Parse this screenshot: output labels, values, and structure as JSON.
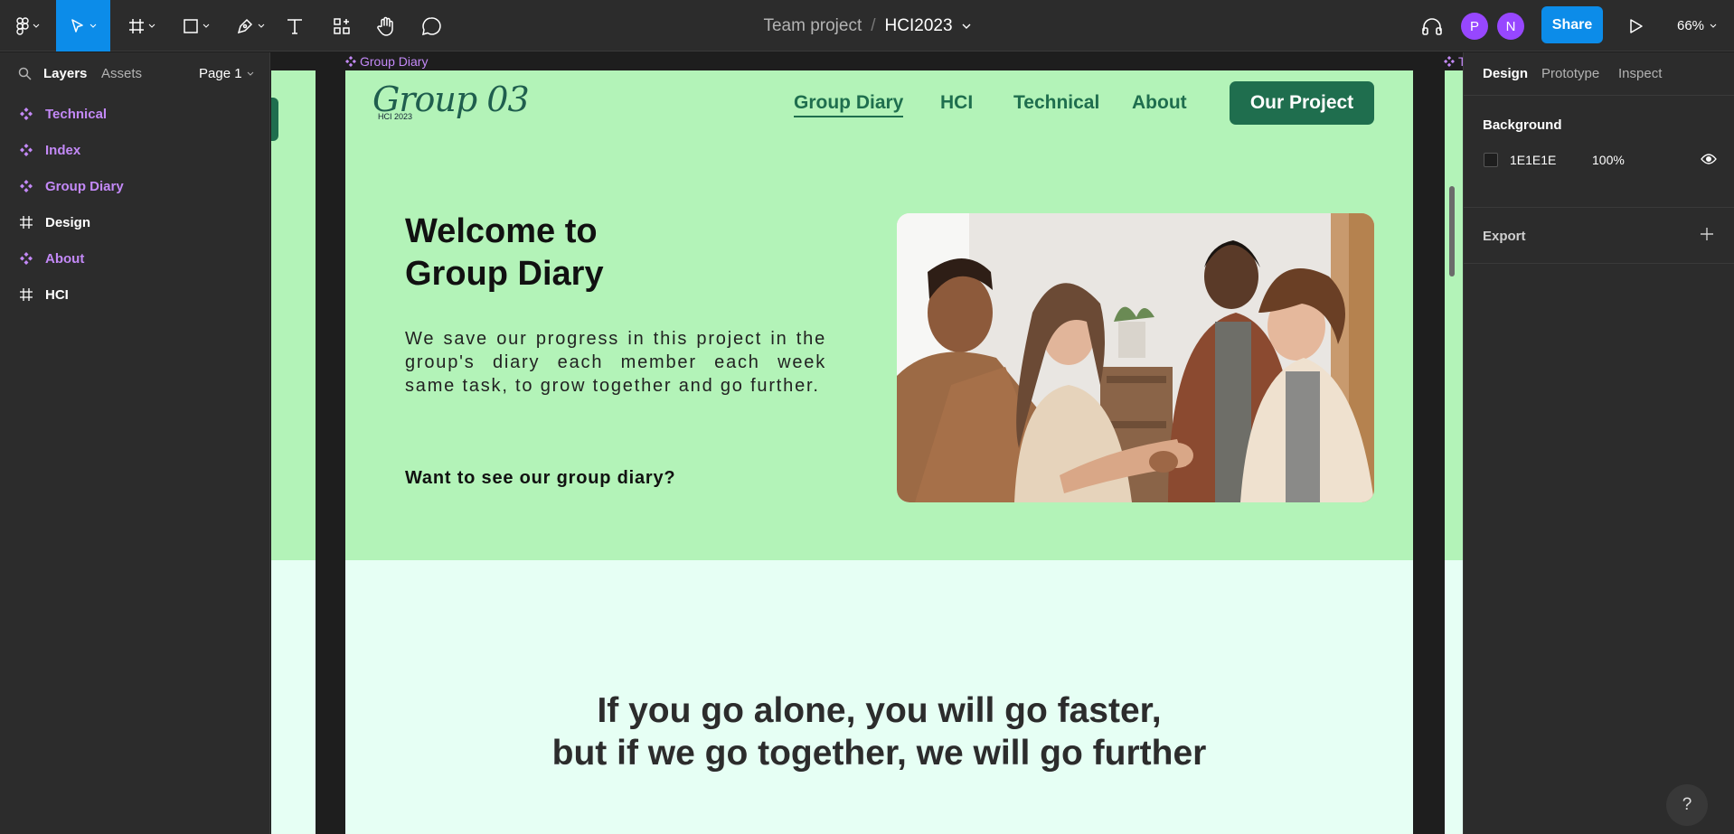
{
  "toolbar": {
    "file_team": "Team project",
    "file_separator": "/",
    "file_name": "HCI2023",
    "avatars": [
      {
        "initial": "P",
        "color": "#9747ff"
      },
      {
        "initial": "N",
        "color": "#9747ff"
      }
    ],
    "share_label": "Share",
    "zoom_label": "66%",
    "icons": [
      "figma-menu-icon",
      "move-tool-icon",
      "frame-tool-icon",
      "shape-tool-icon",
      "pen-tool-icon",
      "text-tool-icon",
      "components-icon",
      "hand-tool-icon",
      "comment-icon",
      "headphones-icon",
      "present-icon"
    ]
  },
  "left_panel": {
    "tab_layers": "Layers",
    "tab_assets": "Assets",
    "page_label": "Page 1",
    "layers": [
      {
        "label": "Technical",
        "kind": "component"
      },
      {
        "label": "Index",
        "kind": "component"
      },
      {
        "label": "Group Diary",
        "kind": "component"
      },
      {
        "label": "Design",
        "kind": "frame"
      },
      {
        "label": "About",
        "kind": "component"
      },
      {
        "label": "HCI",
        "kind": "frame"
      }
    ]
  },
  "canvas": {
    "frame_label": "Group Diary",
    "right_frame_label": "T",
    "site": {
      "logo_script": "Group 03",
      "logo_sub": "HCI 2023",
      "nav": [
        "Group Diary",
        "HCI",
        "Technical",
        "About"
      ],
      "cta": "Our Project",
      "hero_title": "Welcome to Group Diary",
      "hero_title_line1": "Welcome to",
      "hero_title_line2": "Group Diary",
      "hero_body": "We save our progress in this project in the group's diary each member each week same task, to grow together and go further.",
      "hero_question": "Want to see our group  diary?",
      "quote_line1": "If you go alone, you will go faster,",
      "quote_line2": "but if we go together, we will go further"
    },
    "colors": {
      "hero_bg": "#b3f3b8",
      "lower_bg": "#e6fff4",
      "accent": "#1f6e4e"
    }
  },
  "right_panel": {
    "tab_design": "Design",
    "tab_prototype": "Prototype",
    "tab_inspect": "Inspect",
    "background_title": "Background",
    "background_hex": "1E1E1E",
    "background_opacity": "100%",
    "export_title": "Export",
    "help_label": "?"
  }
}
